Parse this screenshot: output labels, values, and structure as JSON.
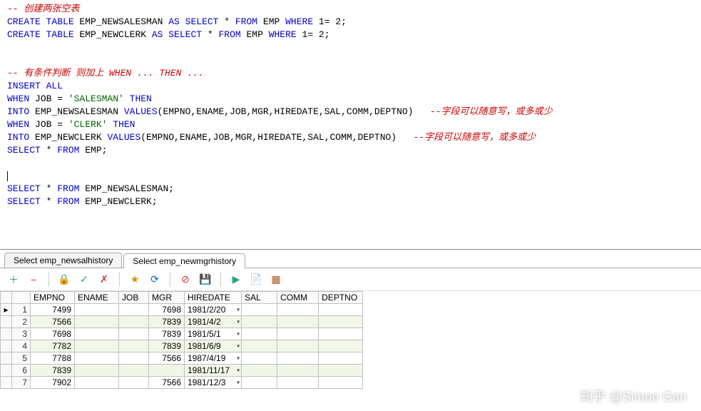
{
  "code": {
    "l1a": "-- ",
    "l1b": "创建两张空表",
    "l2_create": "CREATE",
    "l2_table": " TABLE",
    "l2_name": " EMP_NEWSALESMAN ",
    "l2_as": "AS",
    "l2_select": " SELECT",
    "l2_star": " * ",
    "l2_from": "FROM",
    "l2_tail": " EMP ",
    "l2_where": "WHERE",
    "l2_cond": " 1= 2;",
    "l3_name": " EMP_NEWCLERK ",
    "l5a": "-- ",
    "l5b": "有条件判断 则加上 WHEN ... THEN ...",
    "l6_insert": "INSERT",
    "l6_all": " ALL",
    "l7_when": "WHEN",
    "l7_job": " JOB = ",
    "l7_val": "'SALESMAN'",
    "l7_then": " THEN",
    "l8_into": "INTO",
    "l8_tbl": " EMP_NEWSALESMAN ",
    "l8_values": "VALUES",
    "l8_args": "(EMPNO,ENAME,JOB,MGR,HIREDATE,SAL,COMM,DEPTNO)   ",
    "l8_c1": "--",
    "l8_c2": "字段可以随意写，或多或少",
    "l9_val": "'CLERK'",
    "l10_tbl": " EMP_NEWCLERK ",
    "l11_select": "SELECT",
    "l11_star": " * ",
    "l11_from": "FROM",
    "l11_tail": " EMP;",
    "l13_a": "SELECT",
    "l13_b": " * ",
    "l13_c": "FROM",
    "l13_d": " EMP_NEWSALESMAN;",
    "l14_d": " EMP_NEWCLERK;"
  },
  "tabs": [
    {
      "label": "Select emp_newsalhistory",
      "active": false
    },
    {
      "label": "Select emp_newmgrhistory",
      "active": true
    }
  ],
  "toolbar_icons": {
    "add": "＋",
    "del": "−",
    "post": "✓",
    "cancel": "✗",
    "lock": "🔒",
    "lockopen": "🔓",
    "fav": "★",
    "refresh": "⟳",
    "break": "⊘",
    "save": "💾",
    "exec": "▶",
    "script": "📄",
    "grid": "▦"
  },
  "columns": [
    "EMPNO",
    "ENAME",
    "JOB",
    "MGR",
    "HIREDATE",
    "SAL",
    "COMM",
    "DEPTNO"
  ],
  "rows": [
    {
      "n": 1,
      "sel": true,
      "empno": "7499",
      "ename": "",
      "job": "",
      "mgr": "7698",
      "hiredate": "1981/2/20",
      "sal": "",
      "comm": "",
      "deptno": ""
    },
    {
      "n": 2,
      "shade": true,
      "empno": "7566",
      "ename": "",
      "job": "",
      "mgr": "7839",
      "hiredate": "1981/4/2",
      "sal": "",
      "comm": "",
      "deptno": ""
    },
    {
      "n": 3,
      "empno": "7698",
      "ename": "",
      "job": "",
      "mgr": "7839",
      "hiredate": "1981/5/1",
      "sal": "",
      "comm": "",
      "deptno": ""
    },
    {
      "n": 4,
      "shade": true,
      "empno": "7782",
      "ename": "",
      "job": "",
      "mgr": "7839",
      "hiredate": "1981/6/9",
      "sal": "",
      "comm": "",
      "deptno": ""
    },
    {
      "n": 5,
      "empno": "7788",
      "ename": "",
      "job": "",
      "mgr": "7566",
      "hiredate": "1987/4/19",
      "sal": "",
      "comm": "",
      "deptno": ""
    },
    {
      "n": 6,
      "shade": true,
      "empno": "7839",
      "ename": "",
      "job": "",
      "mgr": "",
      "hiredate": "1981/11/17",
      "sal": "",
      "comm": "",
      "deptno": ""
    },
    {
      "n": 7,
      "empno": "7902",
      "ename": "",
      "job": "",
      "mgr": "7566",
      "hiredate": "1981/12/3",
      "sal": "",
      "comm": "",
      "deptno": ""
    }
  ],
  "watermark": "知乎 @Simon Gan"
}
